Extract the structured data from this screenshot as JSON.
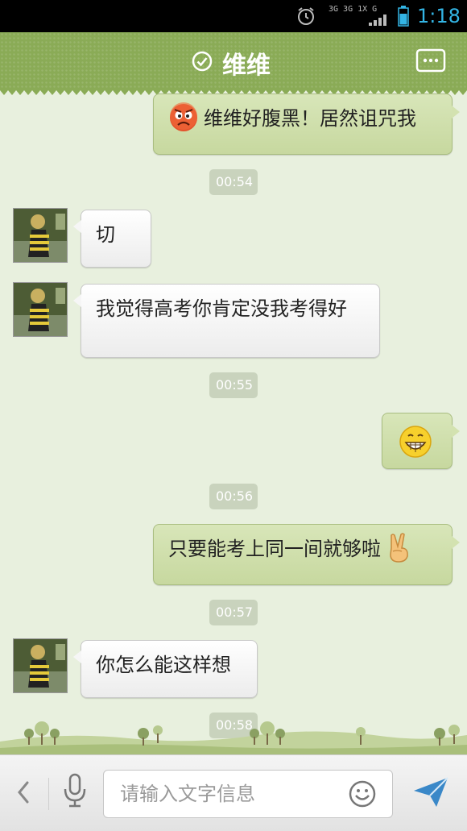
{
  "status_bar": {
    "time": "1:18",
    "network_label": "3G 3G 1X G",
    "icons": [
      "alarm-icon",
      "signal-icon",
      "battery-icon"
    ]
  },
  "header": {
    "title": "维维",
    "status_icon": "check-circle-icon",
    "menu_icon": "more-icon"
  },
  "messages": [
    {
      "type": "out",
      "emoji": "angry-face",
      "text": "维维好腹黑！居然诅咒我"
    },
    {
      "type": "time",
      "text": "00:54"
    },
    {
      "type": "in",
      "text": "切"
    },
    {
      "type": "in",
      "text": "我觉得高考你肯定没我考得好"
    },
    {
      "type": "time",
      "text": "00:55"
    },
    {
      "type": "out",
      "emoji": "grin-face",
      "text": ""
    },
    {
      "type": "time",
      "text": "00:56"
    },
    {
      "type": "out",
      "emoji": "victory-hand",
      "text": "只要能考上同一间就够啦"
    },
    {
      "type": "time",
      "text": "00:57"
    },
    {
      "type": "in",
      "text": "你怎么能这样想"
    },
    {
      "type": "time",
      "text": "00:58"
    }
  ],
  "input_bar": {
    "placeholder": "请输入文字信息",
    "icons": [
      "back-arrow-icon",
      "microphone-icon",
      "smiley-icon",
      "send-icon"
    ]
  },
  "colors": {
    "header_green": "#8aab56",
    "chat_background": "#e8f0de",
    "outgoing_bubble": "#d3e2b0",
    "incoming_bubble": "#f6f6f6",
    "status_time_blue": "#33b5e5"
  }
}
